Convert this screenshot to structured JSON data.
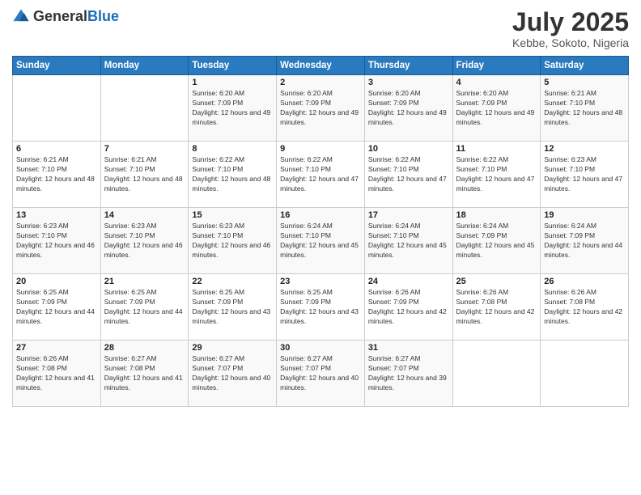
{
  "header": {
    "logo_general": "General",
    "logo_blue": "Blue",
    "month": "July 2025",
    "location": "Kebbe, Sokoto, Nigeria"
  },
  "days_of_week": [
    "Sunday",
    "Monday",
    "Tuesday",
    "Wednesday",
    "Thursday",
    "Friday",
    "Saturday"
  ],
  "weeks": [
    [
      {
        "day": "",
        "info": ""
      },
      {
        "day": "",
        "info": ""
      },
      {
        "day": "1",
        "info": "Sunrise: 6:20 AM\nSunset: 7:09 PM\nDaylight: 12 hours and 49 minutes."
      },
      {
        "day": "2",
        "info": "Sunrise: 6:20 AM\nSunset: 7:09 PM\nDaylight: 12 hours and 49 minutes."
      },
      {
        "day": "3",
        "info": "Sunrise: 6:20 AM\nSunset: 7:09 PM\nDaylight: 12 hours and 49 minutes."
      },
      {
        "day": "4",
        "info": "Sunrise: 6:20 AM\nSunset: 7:09 PM\nDaylight: 12 hours and 49 minutes."
      },
      {
        "day": "5",
        "info": "Sunrise: 6:21 AM\nSunset: 7:10 PM\nDaylight: 12 hours and 48 minutes."
      }
    ],
    [
      {
        "day": "6",
        "info": "Sunrise: 6:21 AM\nSunset: 7:10 PM\nDaylight: 12 hours and 48 minutes."
      },
      {
        "day": "7",
        "info": "Sunrise: 6:21 AM\nSunset: 7:10 PM\nDaylight: 12 hours and 48 minutes."
      },
      {
        "day": "8",
        "info": "Sunrise: 6:22 AM\nSunset: 7:10 PM\nDaylight: 12 hours and 48 minutes."
      },
      {
        "day": "9",
        "info": "Sunrise: 6:22 AM\nSunset: 7:10 PM\nDaylight: 12 hours and 47 minutes."
      },
      {
        "day": "10",
        "info": "Sunrise: 6:22 AM\nSunset: 7:10 PM\nDaylight: 12 hours and 47 minutes."
      },
      {
        "day": "11",
        "info": "Sunrise: 6:22 AM\nSunset: 7:10 PM\nDaylight: 12 hours and 47 minutes."
      },
      {
        "day": "12",
        "info": "Sunrise: 6:23 AM\nSunset: 7:10 PM\nDaylight: 12 hours and 47 minutes."
      }
    ],
    [
      {
        "day": "13",
        "info": "Sunrise: 6:23 AM\nSunset: 7:10 PM\nDaylight: 12 hours and 46 minutes."
      },
      {
        "day": "14",
        "info": "Sunrise: 6:23 AM\nSunset: 7:10 PM\nDaylight: 12 hours and 46 minutes."
      },
      {
        "day": "15",
        "info": "Sunrise: 6:23 AM\nSunset: 7:10 PM\nDaylight: 12 hours and 46 minutes."
      },
      {
        "day": "16",
        "info": "Sunrise: 6:24 AM\nSunset: 7:10 PM\nDaylight: 12 hours and 45 minutes."
      },
      {
        "day": "17",
        "info": "Sunrise: 6:24 AM\nSunset: 7:10 PM\nDaylight: 12 hours and 45 minutes."
      },
      {
        "day": "18",
        "info": "Sunrise: 6:24 AM\nSunset: 7:09 PM\nDaylight: 12 hours and 45 minutes."
      },
      {
        "day": "19",
        "info": "Sunrise: 6:24 AM\nSunset: 7:09 PM\nDaylight: 12 hours and 44 minutes."
      }
    ],
    [
      {
        "day": "20",
        "info": "Sunrise: 6:25 AM\nSunset: 7:09 PM\nDaylight: 12 hours and 44 minutes."
      },
      {
        "day": "21",
        "info": "Sunrise: 6:25 AM\nSunset: 7:09 PM\nDaylight: 12 hours and 44 minutes."
      },
      {
        "day": "22",
        "info": "Sunrise: 6:25 AM\nSunset: 7:09 PM\nDaylight: 12 hours and 43 minutes."
      },
      {
        "day": "23",
        "info": "Sunrise: 6:25 AM\nSunset: 7:09 PM\nDaylight: 12 hours and 43 minutes."
      },
      {
        "day": "24",
        "info": "Sunrise: 6:26 AM\nSunset: 7:09 PM\nDaylight: 12 hours and 42 minutes."
      },
      {
        "day": "25",
        "info": "Sunrise: 6:26 AM\nSunset: 7:08 PM\nDaylight: 12 hours and 42 minutes."
      },
      {
        "day": "26",
        "info": "Sunrise: 6:26 AM\nSunset: 7:08 PM\nDaylight: 12 hours and 42 minutes."
      }
    ],
    [
      {
        "day": "27",
        "info": "Sunrise: 6:26 AM\nSunset: 7:08 PM\nDaylight: 12 hours and 41 minutes."
      },
      {
        "day": "28",
        "info": "Sunrise: 6:27 AM\nSunset: 7:08 PM\nDaylight: 12 hours and 41 minutes."
      },
      {
        "day": "29",
        "info": "Sunrise: 6:27 AM\nSunset: 7:07 PM\nDaylight: 12 hours and 40 minutes."
      },
      {
        "day": "30",
        "info": "Sunrise: 6:27 AM\nSunset: 7:07 PM\nDaylight: 12 hours and 40 minutes."
      },
      {
        "day": "31",
        "info": "Sunrise: 6:27 AM\nSunset: 7:07 PM\nDaylight: 12 hours and 39 minutes."
      },
      {
        "day": "",
        "info": ""
      },
      {
        "day": "",
        "info": ""
      }
    ]
  ]
}
